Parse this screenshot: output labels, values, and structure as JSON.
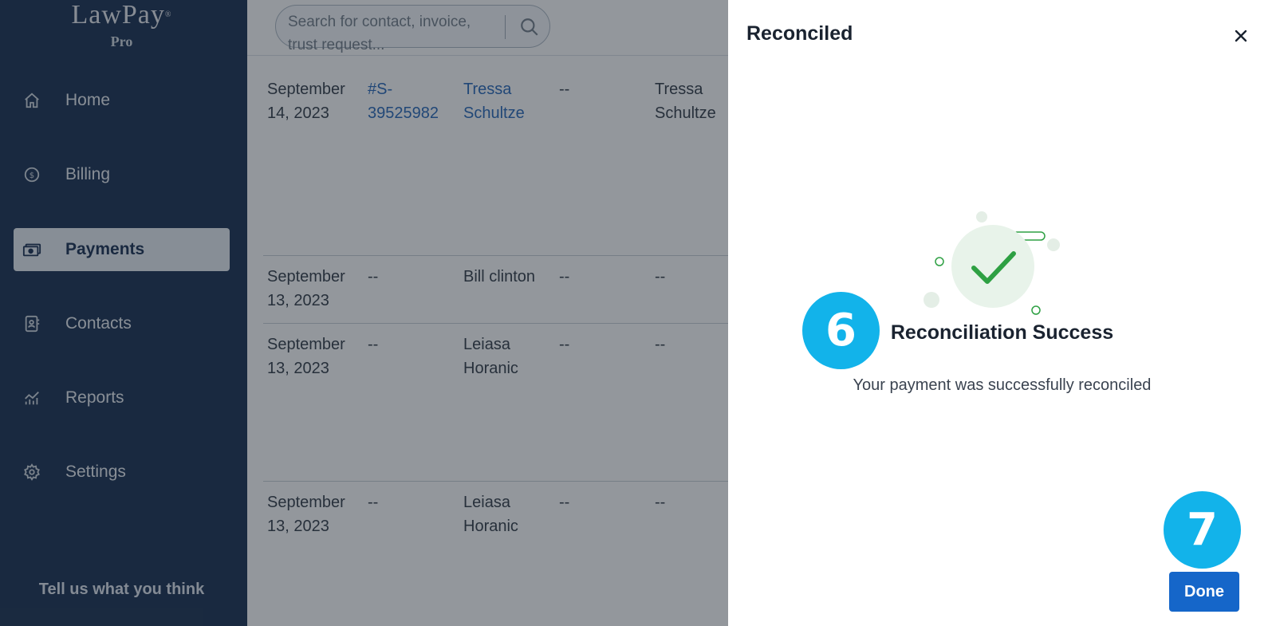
{
  "logo": {
    "main": "LawPay",
    "tm": "®",
    "sub": "Pro"
  },
  "sidebar": {
    "items": [
      {
        "label": "Home",
        "icon": "home-icon"
      },
      {
        "label": "Billing",
        "icon": "dollar-circle-icon"
      },
      {
        "label": "Payments",
        "icon": "cash-icon",
        "active": true
      },
      {
        "label": "Contacts",
        "icon": "contact-book-icon"
      },
      {
        "label": "Reports",
        "icon": "chart-icon"
      },
      {
        "label": "Settings",
        "icon": "gear-icon"
      }
    ],
    "feedback": "Tell us what you think"
  },
  "search": {
    "placeholder": "Search for contact, invoice, trust request..."
  },
  "table": {
    "rows": [
      {
        "date": "September 14, 2023",
        "invoice": "#S-39525982",
        "contact": "Tressa Schultze",
        "col4": "--",
        "col5": "Tressa Schultze"
      },
      {
        "date": "September 13, 2023",
        "invoice": "--",
        "contact": "Bill clinton",
        "col4": "--",
        "col5": "--"
      },
      {
        "date": "September 13, 2023",
        "invoice": "--",
        "contact": "Leiasa Horanic",
        "col4": "--",
        "col5": "--"
      },
      {
        "date": "September 13, 2023",
        "invoice": "--",
        "contact": "Leiasa Horanic",
        "col4": "--",
        "col5": "--"
      }
    ]
  },
  "panel": {
    "title": "Reconciled",
    "success_title": "Reconciliation Success",
    "success_message": "Your payment was successfully reconciled",
    "done_label": "Done"
  },
  "steps": {
    "six": "6",
    "seven": "7"
  },
  "colors": {
    "sidebar": "#0b2346",
    "accent": "#1566c9",
    "success": "#2ea043",
    "step": "#12b3ea"
  }
}
